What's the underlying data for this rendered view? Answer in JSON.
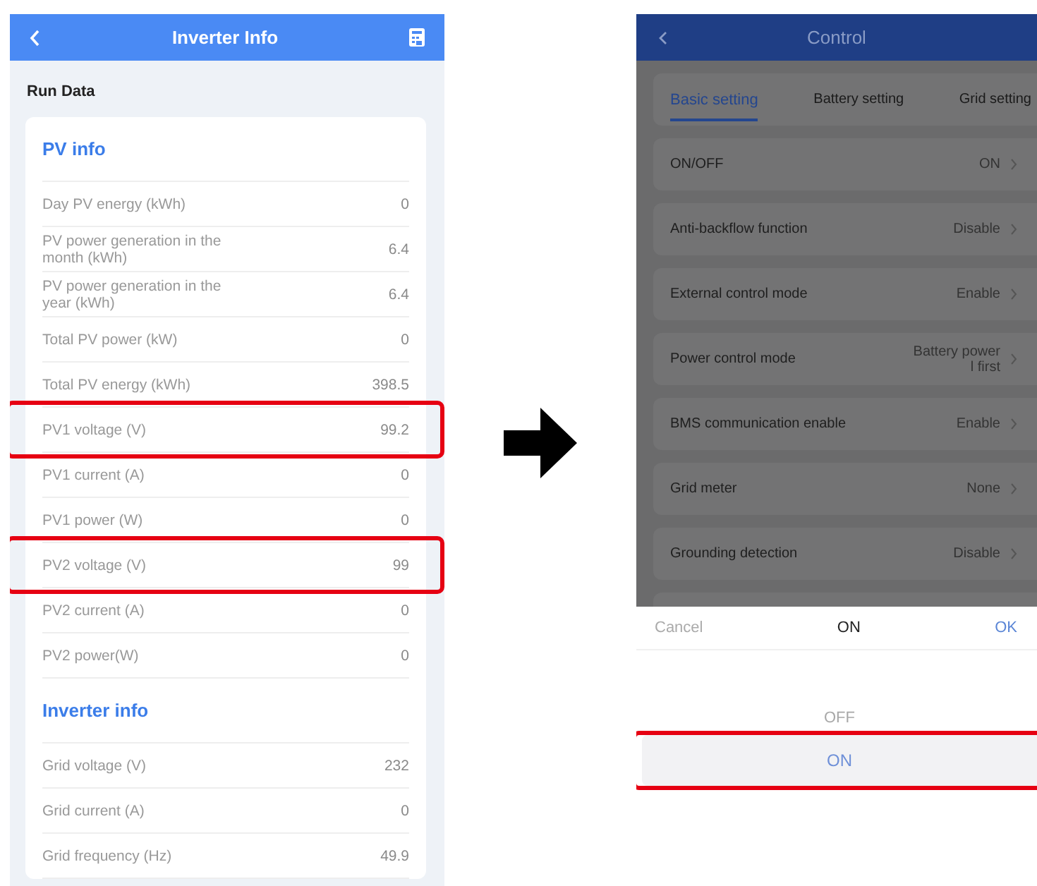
{
  "inverter_info": {
    "title": "Inverter Info",
    "section": "Run Data",
    "groups": [
      {
        "title": "PV info",
        "rows": [
          {
            "label": "Day PV energy (kWh)",
            "value": "0",
            "highlighted": false
          },
          {
            "label": "PV power generation in the month (kWh)",
            "value": "6.4",
            "highlighted": false
          },
          {
            "label": "PV power generation in the year (kWh)",
            "value": "6.4",
            "highlighted": false
          },
          {
            "label": "Total PV power (kW)",
            "value": "0",
            "highlighted": false
          },
          {
            "label": "Total PV energy (kWh)",
            "value": "398.5",
            "highlighted": false
          },
          {
            "label": "PV1 voltage (V)",
            "value": "99.2",
            "highlighted": true
          },
          {
            "label": "PV1 current (A)",
            "value": "0",
            "highlighted": false
          },
          {
            "label": "PV1 power (W)",
            "value": "0",
            "highlighted": false
          },
          {
            "label": "PV2 voltage (V)",
            "value": "99",
            "highlighted": true
          },
          {
            "label": "PV2 current (A)",
            "value": "0",
            "highlighted": false
          },
          {
            "label": "PV2 power(W)",
            "value": "0",
            "highlighted": false
          }
        ]
      },
      {
        "title": "Inverter info",
        "rows": [
          {
            "label": "Grid voltage (V)",
            "value": "232",
            "highlighted": false
          },
          {
            "label": "Grid current (A)",
            "value": "0",
            "highlighted": false
          },
          {
            "label": "Grid frequency (Hz)",
            "value": "49.9",
            "highlighted": false
          }
        ]
      }
    ]
  },
  "control": {
    "title": "Control",
    "tabs": [
      {
        "label": "Basic setting",
        "selected": true
      },
      {
        "label": "Battery setting",
        "selected": false
      },
      {
        "label": "Grid setting",
        "selected": false
      }
    ],
    "settings": [
      {
        "label": "ON/OFF",
        "value": "ON"
      },
      {
        "label": "Anti-backflow function",
        "value": "Disable"
      },
      {
        "label": "External control mode",
        "value": "Enable"
      },
      {
        "label": "Power control mode",
        "value": "Battery power l first"
      },
      {
        "label": "BMS communication enable",
        "value": "Enable"
      },
      {
        "label": "Grid meter",
        "value": "None"
      },
      {
        "label": "Grounding detection",
        "value": "Disable"
      }
    ],
    "picker": {
      "cancel": "Cancel",
      "title": "ON",
      "confirm": "OK",
      "options": [
        {
          "label": "OFF",
          "selected": false,
          "highlighted": false
        },
        {
          "label": "ON",
          "selected": true,
          "highlighted": true
        }
      ]
    }
  }
}
